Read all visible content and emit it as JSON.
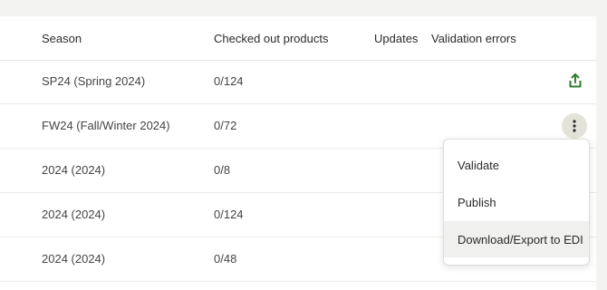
{
  "table": {
    "columns": {
      "season": "Season",
      "checked_out": "Checked out products",
      "updates": "Updates",
      "validation": "Validation errors"
    },
    "rows": [
      {
        "season": "SP24 (Spring 2024)",
        "checked_out": "0/124"
      },
      {
        "season": "FW24 (Fall/Winter 2024)",
        "checked_out": "0/72"
      },
      {
        "season": "2024 (2024)",
        "checked_out": "0/8"
      },
      {
        "season": "2024 (2024)",
        "checked_out": "0/124"
      },
      {
        "season": "2024 (2024)",
        "checked_out": "0/48"
      }
    ]
  },
  "menu": {
    "items": [
      "Validate",
      "Publish",
      "Download/Export to EDI"
    ]
  },
  "icons": {
    "share": "share-upload-icon",
    "more": "more-vertical-icon"
  },
  "colors": {
    "accent_green": "#2e7d32",
    "kebab_bg": "#e4e3da"
  }
}
